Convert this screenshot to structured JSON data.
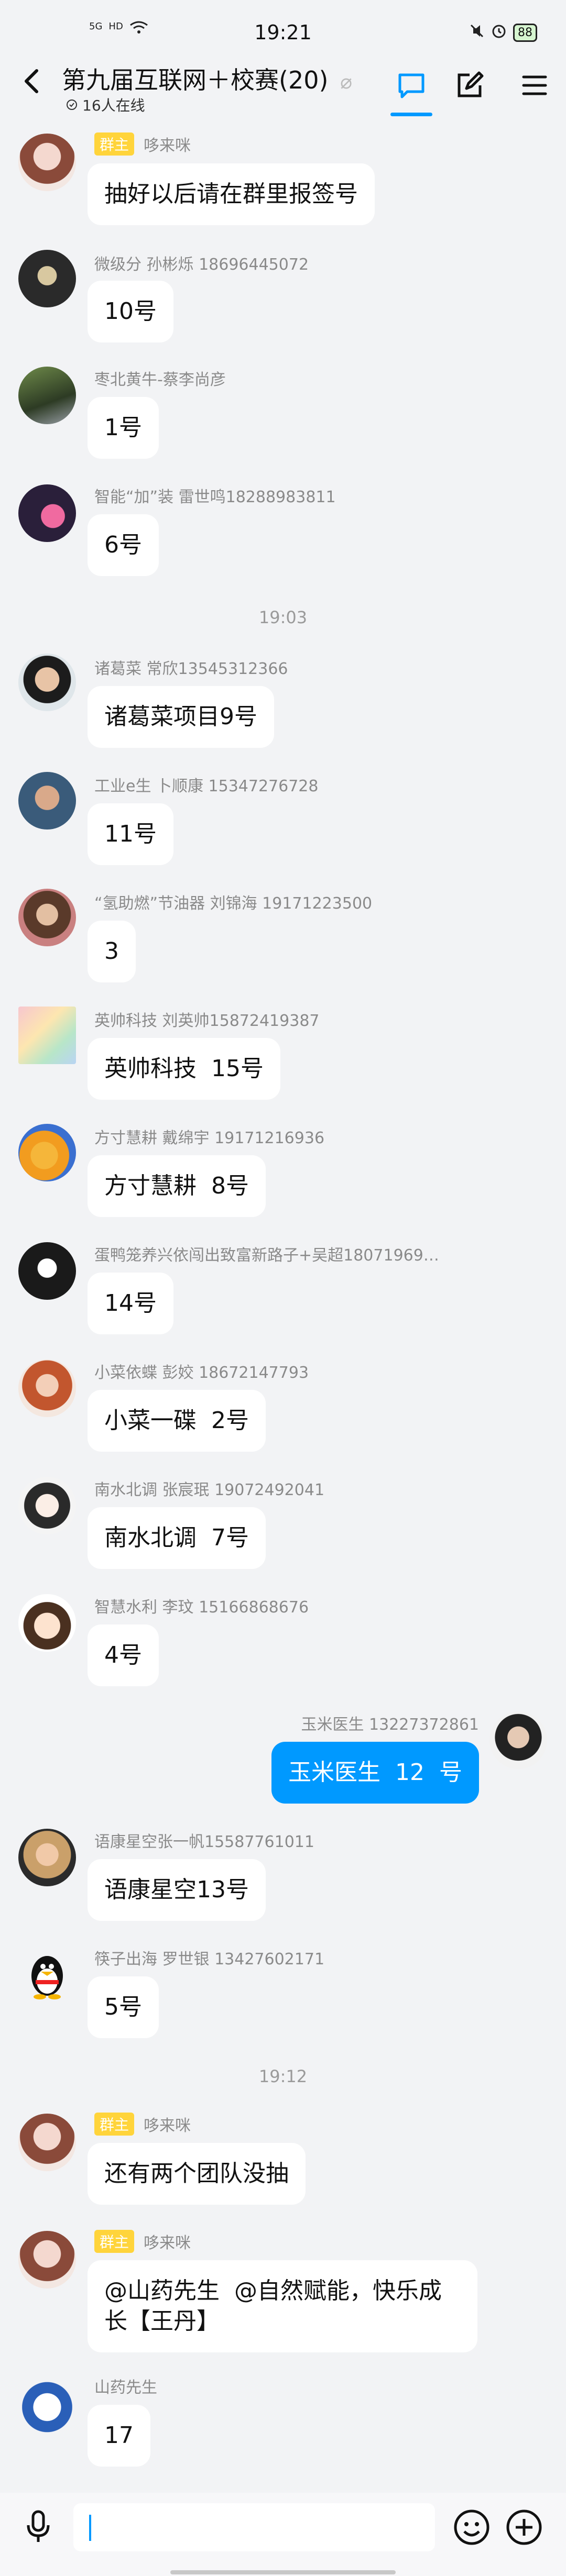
{
  "status_bar": {
    "time": "19:21",
    "network": "5G",
    "hd": "HD",
    "battery": "88"
  },
  "header": {
    "title": "第九届互联网＋校赛(20)",
    "online": "16人在线"
  },
  "messages": [
    {
      "role": "群主",
      "sender": "哆来咪",
      "text": "抽好以后请在群里报签号"
    },
    {
      "role": "",
      "sender": "微级分  孙彬烁  18696445072",
      "text": "10号"
    },
    {
      "role": "",
      "sender": "枣北黄牛-蔡李尚彦",
      "text": "1号"
    },
    {
      "role": "",
      "sender": "智能“加”装  雷世鸣18288983811",
      "text": "6号"
    },
    {
      "role": "",
      "sender": "诸葛菜       常欣13545312366",
      "text": "诸葛菜项目9号"
    },
    {
      "role": "",
      "sender": "工业e生  卜顺康  15347276728",
      "text": "11号"
    },
    {
      "role": "",
      "sender": "“氢助燃”节油器  刘锦海  19171223500",
      "text": "3"
    },
    {
      "role": "",
      "sender": "英帅科技  刘英帅15872419387",
      "text": "英帅科技  15号"
    },
    {
      "role": "",
      "sender": "方寸慧耕  戴绵宇  19171216936",
      "text": "方寸慧耕  8号"
    },
    {
      "role": "",
      "sender": "蛋鸭笼养兴依闯出致富新路子+吴超18071969…",
      "text": "14号"
    },
    {
      "role": "",
      "sender": "小菜依蝶  彭姣  18672147793",
      "text": "小菜一碟  2号"
    },
    {
      "role": "",
      "sender": "南水北调  张宸珉  19072492041",
      "text": "南水北调  7号"
    },
    {
      "role": "",
      "sender": "智慧水利  李玟  15166868676",
      "text": "4号"
    },
    {
      "role": "",
      "sender": "玉米医生  13227372861",
      "text": "玉米医生  12  号"
    },
    {
      "role": "",
      "sender": "语康星空张一帆15587761011",
      "text": "语康星空13号"
    },
    {
      "role": "",
      "sender": "筷子出海  罗世银  13427602171",
      "text": "5号"
    },
    {
      "role": "群主",
      "sender": "哆来咪",
      "text": "还有两个团队没抽"
    },
    {
      "role": "群主",
      "sender": "哆来咪",
      "text": "@山药先生  @自然赋能，快乐成\n长【王丹】"
    },
    {
      "role": "",
      "sender": "山药先生",
      "text": "17"
    }
  ],
  "time_separators": [
    "19:03",
    "19:12"
  ],
  "colors": {
    "accent": "#0099ff",
    "badge": "#ffd43b",
    "background": "#f2f3f5"
  }
}
